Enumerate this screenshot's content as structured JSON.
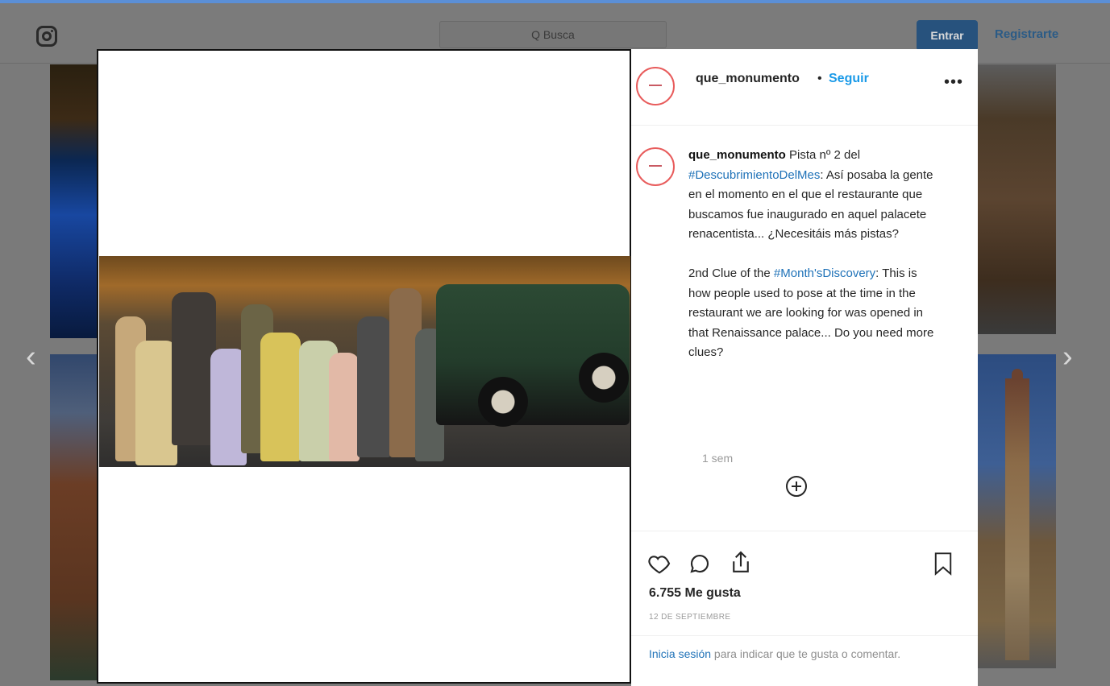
{
  "header": {
    "search_placeholder": "Q Busca",
    "login_label": "Entrar",
    "signup_label": "Registrarte"
  },
  "post": {
    "username": "que_monumento",
    "separator": "•",
    "follow_label": "Seguir",
    "more_label": "•••",
    "caption_user": "que_monumento",
    "caption_p1_before_tag": "Pista nº 2 del ",
    "caption_tag1": "#DescubrimientoDelMes",
    "caption_p1_after_tag": ": Así posaba la gente en el momento en el que el restaurante que buscamos fue inaugurado en aquel palacete renacentista... ¿Necesitáis más pistas?",
    "caption_p2_before_tag": "2nd Clue of the ",
    "caption_tag2": "#Month'sDiscovery",
    "caption_p2_after_tag": ": This is how people used to pose at the time in the restaurant we are looking for was opened in that Renaissance palace... Do you need more clues?",
    "time_ago": "1 sem",
    "likes": "6.755 Me gusta",
    "date": "12 DE SEPTIEMBRE",
    "login_link": "Inicia sesión",
    "login_rest": " para indicar que te gusta o comentar."
  },
  "nav": {
    "prev_arrow": "‹",
    "next_arrow": "›"
  },
  "icons": {
    "instagram": "instagram-icon",
    "search": "search-icon",
    "heart": "heart-icon",
    "comment": "comment-icon",
    "share": "share-icon",
    "save": "bookmark-icon",
    "plus": "plus-circle-icon"
  },
  "colors": {
    "follow": "#1a9ae8",
    "hashtag": "#1f72b8",
    "login_button": "#27527d"
  }
}
